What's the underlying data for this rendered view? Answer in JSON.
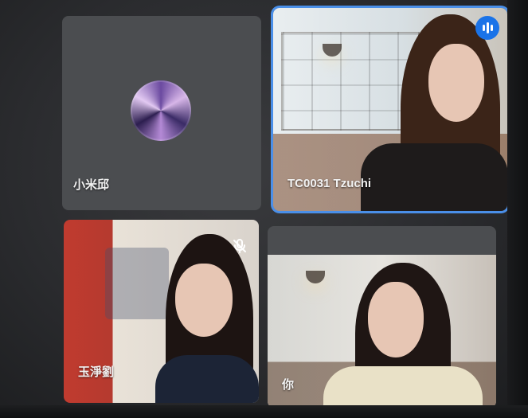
{
  "participants": [
    {
      "name": "小米邱"
    },
    {
      "name": "TC0031 Tzuchi"
    },
    {
      "name": "玉淨劉"
    },
    {
      "name": "你"
    }
  ],
  "indicators": {
    "active_speaker": "speaking-icon",
    "muted": "mic-off-icon"
  },
  "colors": {
    "tile_placeholder": "#4b4d50",
    "active_border": "#4a8fe8",
    "speaking_badge": "#1a73e8"
  }
}
